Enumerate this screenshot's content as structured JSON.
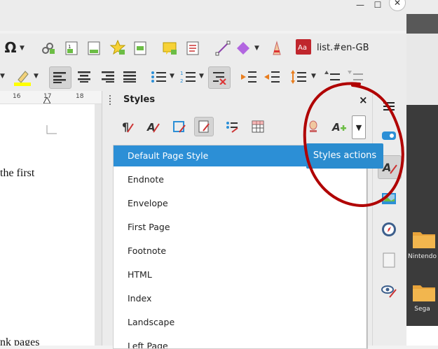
{
  "toolbar": {
    "language_label": "list.#en-GB"
  },
  "ruler": {
    "ticks": [
      "16",
      "17",
      "18"
    ]
  },
  "document": {
    "line1": "the first",
    "line2": "nk pages"
  },
  "styles_panel": {
    "title": "Styles",
    "close_glyph": "×",
    "items": [
      "Default Page Style",
      "Endnote",
      "Envelope",
      "First Page",
      "Footnote",
      "HTML",
      "Index",
      "Landscape",
      "Left Page"
    ],
    "selected_index": 0
  },
  "tooltip": {
    "text": "Styles actions"
  },
  "desktop": {
    "folders": [
      "Nintendo",
      "Sega"
    ]
  },
  "colors": {
    "selection": "#2c8fd6",
    "tooltip": "#2a8ccf",
    "annotation": "#b00000"
  }
}
